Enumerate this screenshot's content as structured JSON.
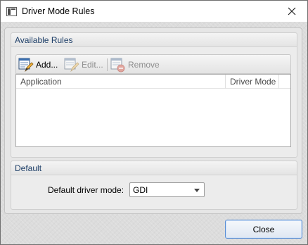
{
  "window": {
    "title": "Driver Mode Rules"
  },
  "icons": {
    "app": "window-app-icon",
    "close": "close-icon",
    "add": "add-rule-icon",
    "edit": "edit-rule-icon",
    "remove": "remove-rule-icon",
    "dropdown": "chevron-down-icon"
  },
  "available_rules": {
    "title": "Available Rules",
    "toolbar": {
      "add_label": "Add...",
      "edit_label": "Edit...",
      "remove_label": "Remove"
    },
    "table": {
      "columns": [
        "Application",
        "Driver Mode"
      ],
      "rows": []
    }
  },
  "default_section": {
    "title": "Default",
    "field_label": "Default driver mode:",
    "selected_value": "GDI"
  },
  "footer": {
    "close_label": "Close"
  }
}
